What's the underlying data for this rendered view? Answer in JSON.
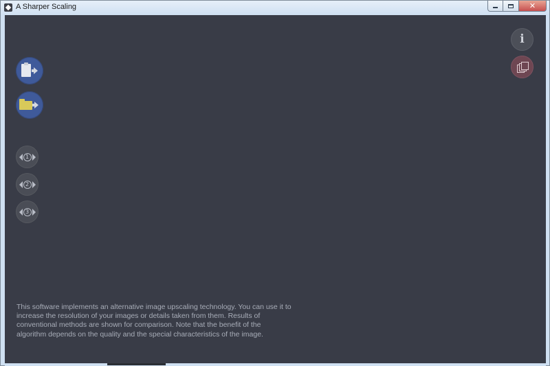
{
  "window": {
    "title": "A Sharper Scaling",
    "controls": {
      "minimize_icon": "minimize-icon",
      "maximize_icon": "maximize-icon",
      "close_glyph": "✕"
    }
  },
  "colors": {
    "background": "#393c47",
    "primary_button": "#3f5a9a",
    "method_button": "#4a4d56",
    "info_button": "#4c4f58",
    "compare_button": "#6e4652",
    "folder": "#d8c95a",
    "text": "#a8adb8"
  },
  "left_actions": [
    {
      "name": "paste-from-clipboard-button",
      "icon": "clipboard-arrow-icon"
    },
    {
      "name": "open-folder-button",
      "icon": "folder-arrow-icon"
    }
  ],
  "methods": [
    {
      "number": "1",
      "icon": "eye-method-icon"
    },
    {
      "number": "2",
      "icon": "eye-method-icon"
    },
    {
      "number": "3",
      "icon": "eye-method-icon"
    }
  ],
  "right_actions": {
    "info": {
      "icon": "info-icon",
      "glyph": "i"
    },
    "pages": {
      "icon": "pages-icon"
    }
  },
  "description": "This software implements an alternative image upscaling technology. You can use it to increase the resolution of your images or details taken from them. Results of conventional methods are shown for comparison. Note that the benefit of the algorithm depends on the quality and the special characteristics of the image."
}
